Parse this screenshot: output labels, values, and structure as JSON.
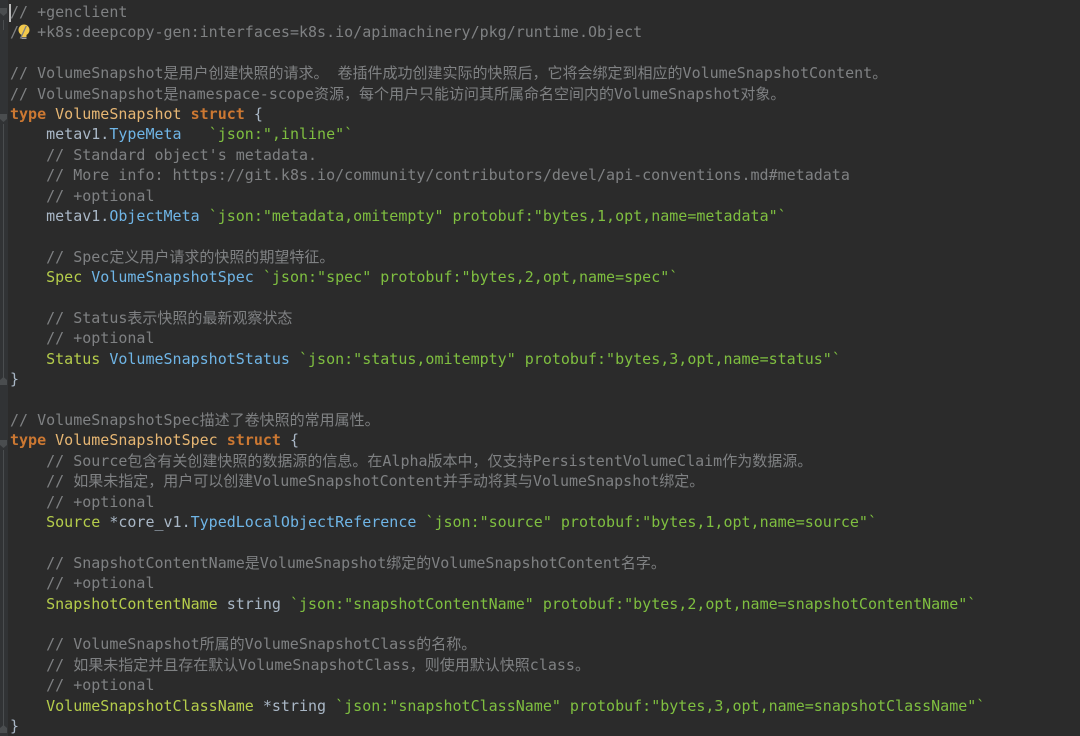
{
  "editor": {
    "lines": [
      {
        "indent": "",
        "parts": [
          {
            "t": "// +genclient",
            "c": "comment"
          }
        ]
      },
      {
        "indent": "",
        "parts": [
          {
            "t": "// +k8s:deepcopy-gen:interfaces=k8s.io/apimachinery/pkg/runtime.Object",
            "c": "comment"
          }
        ]
      },
      {
        "indent": "",
        "parts": []
      },
      {
        "indent": "",
        "parts": [
          {
            "t": "// VolumeSnapshot是用户创建快照的请求。 卷插件成功创建实际的快照后，它将会绑定到相应的VolumeSnapshotContent。",
            "c": "comment"
          }
        ]
      },
      {
        "indent": "",
        "parts": [
          {
            "t": "// VolumeSnapshot是namespace-scope资源，每个用户只能访问其所属命名空间内的VolumeSnapshot对象。",
            "c": "comment"
          }
        ]
      },
      {
        "indent": "",
        "parts": [
          {
            "t": "type ",
            "c": "kw"
          },
          {
            "t": "VolumeSnapshot ",
            "c": "type-name"
          },
          {
            "t": "struct",
            "c": "kw"
          },
          {
            "t": " {",
            "c": "punct"
          }
        ]
      },
      {
        "indent": "    ",
        "parts": [
          {
            "t": "metav1.",
            "c": "pkg"
          },
          {
            "t": "TypeMeta",
            "c": "typeref"
          },
          {
            "t": "   ",
            "c": "punct"
          },
          {
            "t": "`json:\",inline\"`",
            "c": "tag"
          }
        ]
      },
      {
        "indent": "    ",
        "parts": [
          {
            "t": "// Standard object's metadata.",
            "c": "comment"
          }
        ]
      },
      {
        "indent": "    ",
        "parts": [
          {
            "t": "// More info: https://git.k8s.io/community/contributors/devel/api-conventions.md#metadata",
            "c": "comment"
          }
        ]
      },
      {
        "indent": "    ",
        "parts": [
          {
            "t": "// +optional",
            "c": "comment"
          }
        ]
      },
      {
        "indent": "    ",
        "parts": [
          {
            "t": "metav1.",
            "c": "pkg"
          },
          {
            "t": "ObjectMeta",
            "c": "typeref"
          },
          {
            "t": " ",
            "c": "punct"
          },
          {
            "t": "`json:\"metadata,omitempty\" protobuf:\"bytes,1,opt,name=metadata\"`",
            "c": "tag"
          }
        ]
      },
      {
        "indent": "",
        "parts": []
      },
      {
        "indent": "    ",
        "parts": [
          {
            "t": "// Spec定义用户请求的快照的期望特征。",
            "c": "comment"
          }
        ]
      },
      {
        "indent": "    ",
        "parts": [
          {
            "t": "Spec",
            "c": "field"
          },
          {
            "t": " ",
            "c": "punct"
          },
          {
            "t": "VolumeSnapshotSpec",
            "c": "typeref"
          },
          {
            "t": " ",
            "c": "punct"
          },
          {
            "t": "`json:\"spec\" protobuf:\"bytes,2,opt,name=spec\"`",
            "c": "tag"
          }
        ]
      },
      {
        "indent": "",
        "parts": []
      },
      {
        "indent": "    ",
        "parts": [
          {
            "t": "// Status表示快照的最新观察状态",
            "c": "comment"
          }
        ]
      },
      {
        "indent": "    ",
        "parts": [
          {
            "t": "// +optional",
            "c": "comment"
          }
        ]
      },
      {
        "indent": "    ",
        "parts": [
          {
            "t": "Status",
            "c": "field"
          },
          {
            "t": " ",
            "c": "punct"
          },
          {
            "t": "VolumeSnapshotStatus",
            "c": "typeref"
          },
          {
            "t": " ",
            "c": "punct"
          },
          {
            "t": "`json:\"status,omitempty\" protobuf:\"bytes,3,opt,name=status\"`",
            "c": "tag"
          }
        ]
      },
      {
        "indent": "",
        "parts": [
          {
            "t": "}",
            "c": "punct"
          }
        ]
      },
      {
        "indent": "",
        "parts": []
      },
      {
        "indent": "",
        "parts": [
          {
            "t": "// VolumeSnapshotSpec描述了卷快照的常用属性。",
            "c": "comment"
          }
        ]
      },
      {
        "indent": "",
        "parts": [
          {
            "t": "type ",
            "c": "kw"
          },
          {
            "t": "VolumeSnapshotSpec ",
            "c": "type-name"
          },
          {
            "t": "struct",
            "c": "kw"
          },
          {
            "t": " {",
            "c": "punct"
          }
        ]
      },
      {
        "indent": "    ",
        "parts": [
          {
            "t": "// Source包含有关创建快照的数据源的信息。在Alpha版本中，仅支持PersistentVolumeClaim作为数据源。",
            "c": "comment"
          }
        ]
      },
      {
        "indent": "    ",
        "parts": [
          {
            "t": "// 如果未指定，用户可以创建VolumeSnapshotContent并手动将其与VolumeSnapshot绑定。",
            "c": "comment"
          }
        ]
      },
      {
        "indent": "    ",
        "parts": [
          {
            "t": "// +optional",
            "c": "comment"
          }
        ]
      },
      {
        "indent": "    ",
        "parts": [
          {
            "t": "Source",
            "c": "field"
          },
          {
            "t": " *core_v1.",
            "c": "pkg"
          },
          {
            "t": "TypedLocalObjectReference",
            "c": "typeref"
          },
          {
            "t": " ",
            "c": "punct"
          },
          {
            "t": "`json:\"source\" protobuf:\"bytes,1,opt,name=source\"`",
            "c": "tag"
          }
        ]
      },
      {
        "indent": "",
        "parts": []
      },
      {
        "indent": "    ",
        "parts": [
          {
            "t": "// SnapshotContentName是VolumeSnapshot绑定的VolumeSnapshotContent名字。",
            "c": "comment"
          }
        ]
      },
      {
        "indent": "    ",
        "parts": [
          {
            "t": "// +optional",
            "c": "comment"
          }
        ]
      },
      {
        "indent": "    ",
        "parts": [
          {
            "t": "SnapshotContentName",
            "c": "field"
          },
          {
            "t": " string ",
            "c": "pkg"
          },
          {
            "t": "`json:\"snapshotContentName\" protobuf:\"bytes,2,opt,name=snapshotContentName\"`",
            "c": "tag"
          }
        ]
      },
      {
        "indent": "",
        "parts": []
      },
      {
        "indent": "    ",
        "parts": [
          {
            "t": "// VolumeSnapshot所属的VolumeSnapshotClass的名称。",
            "c": "comment"
          }
        ]
      },
      {
        "indent": "    ",
        "parts": [
          {
            "t": "// 如果未指定并且存在默认VolumeSnapshotClass，则使用默认快照class。",
            "c": "comment"
          }
        ]
      },
      {
        "indent": "    ",
        "parts": [
          {
            "t": "// +optional",
            "c": "comment"
          }
        ]
      },
      {
        "indent": "    ",
        "parts": [
          {
            "t": "VolumeSnapshotClassName",
            "c": "field"
          },
          {
            "t": " *string ",
            "c": "pkg"
          },
          {
            "t": "`json:\"snapshotClassName\" protobuf:\"bytes,3,opt,name=snapshotClassName\"`",
            "c": "tag"
          }
        ]
      },
      {
        "indent": "",
        "parts": [
          {
            "t": "}",
            "c": "punct"
          }
        ]
      }
    ]
  },
  "icons": {
    "intention": "lightbulb-icon",
    "fold": "fold-marker-icon"
  },
  "colors": {
    "background": "#2b2b2b",
    "keyword": "#cc7832",
    "comment": "#7f8183",
    "tag": "#7fbf40",
    "field": "#b5cd4b",
    "type": "#6fb5e6"
  }
}
